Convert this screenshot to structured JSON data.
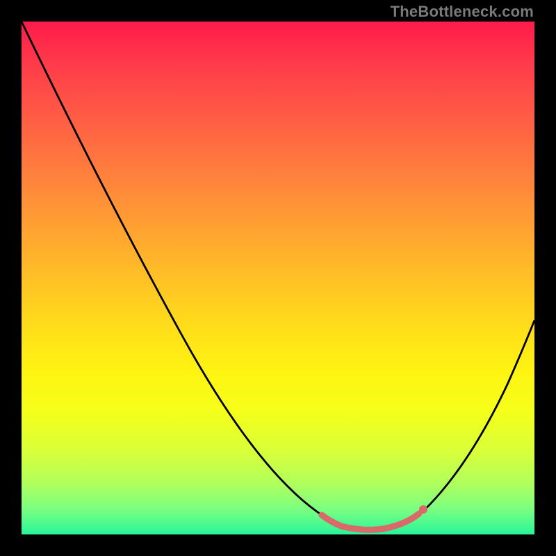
{
  "watermark": "TheBottleneck.com",
  "colors": {
    "gradient_top": "#ff1a4b",
    "gradient_bottom": "#28f59a",
    "curve": "#000000",
    "marker": "#d86a6a",
    "frame": "#000000",
    "watermark": "#7a7a7a"
  },
  "chart_data": {
    "type": "line",
    "title": "",
    "xlabel": "",
    "ylabel": "",
    "note": "No axis ticks or labels are visible; values are read from normalized plot-area pixel coordinates (0–100 each axis, y=0 at top).",
    "series": [
      {
        "name": "bottleneck-curve",
        "x": [
          0,
          15,
          31,
          46,
          59,
          64,
          69,
          74,
          77,
          87,
          95,
          100
        ],
        "y": [
          0,
          32,
          61,
          88,
          96,
          99,
          99,
          99,
          96,
          88,
          70,
          58
        ]
      },
      {
        "name": "optimal-range-marker",
        "x": [
          59,
          62,
          66,
          70,
          75,
          78
        ],
        "y": [
          96,
          98,
          99,
          99,
          98,
          96
        ]
      }
    ],
    "xlim": [
      0,
      100
    ],
    "ylim": [
      0,
      100
    ],
    "grid": false,
    "legend": false
  }
}
